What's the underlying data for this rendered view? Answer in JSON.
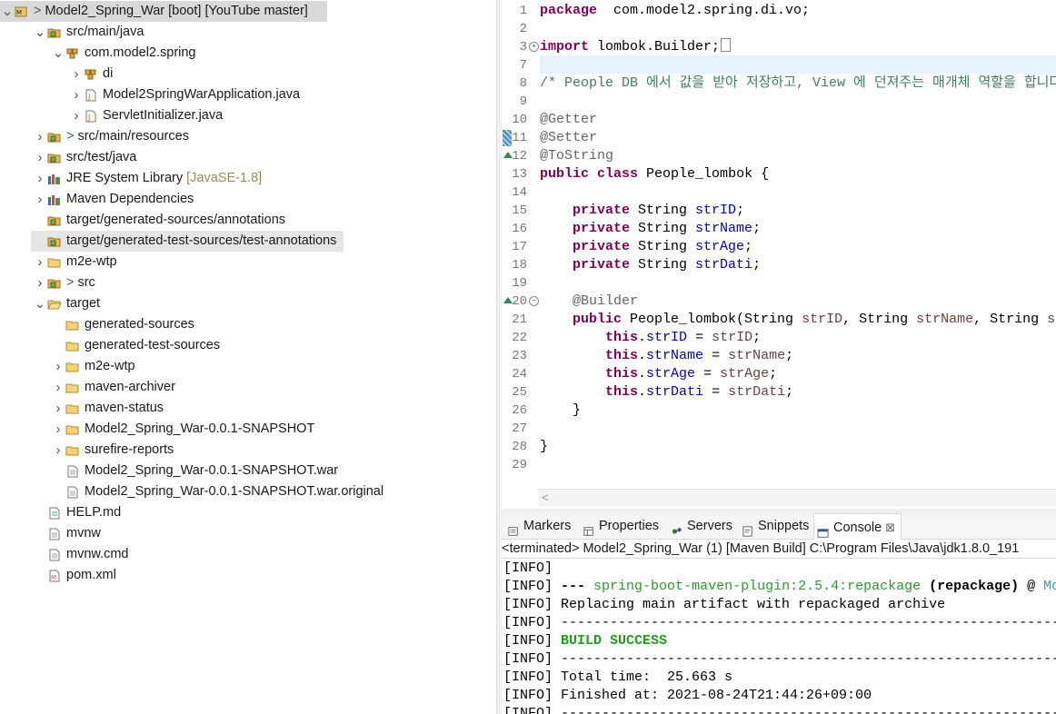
{
  "explorer": {
    "rows": [
      {
        "indent": 0,
        "twisty": "v",
        "icon": "maven-project-icon",
        "prefix": ">",
        "text": "Model2_Spring_War",
        "dim": " [boot] [YouTube master]",
        "selected": true
      },
      {
        "indent": 1,
        "twisty": "v",
        "icon": "source-folder-icon",
        "prefix": "",
        "text": "src/main/java",
        "dim": ""
      },
      {
        "indent": 2,
        "twisty": "v",
        "icon": "package-icon",
        "prefix": "",
        "text": "com.model2.spring",
        "dim": ""
      },
      {
        "indent": 3,
        "twisty": ">",
        "icon": "package-icon",
        "prefix": "",
        "text": "di",
        "dim": ""
      },
      {
        "indent": 3,
        "twisty": ">",
        "icon": "java-file-icon",
        "prefix": "",
        "text": "Model2SpringWarApplication.java",
        "dim": ""
      },
      {
        "indent": 3,
        "twisty": ">",
        "icon": "java-file-icon",
        "prefix": "",
        "text": "ServletInitializer.java",
        "dim": ""
      },
      {
        "indent": 1,
        "twisty": ">",
        "icon": "source-folder-icon",
        "prefix": ">",
        "text": "src/main/resources",
        "dim": ""
      },
      {
        "indent": 1,
        "twisty": ">",
        "icon": "source-folder-icon",
        "prefix": "",
        "text": "src/test/java",
        "dim": ""
      },
      {
        "indent": 1,
        "twisty": ">",
        "icon": "library-icon",
        "prefix": "",
        "text": "JRE System Library",
        "dim": " [JavaSE-1.8]"
      },
      {
        "indent": 1,
        "twisty": ">",
        "icon": "library-icon",
        "prefix": "",
        "text": "Maven Dependencies",
        "dim": ""
      },
      {
        "indent": 1,
        "twisty": "",
        "icon": "source-folder-icon",
        "prefix": "",
        "text": "target/generated-sources/annotations",
        "dim": ""
      },
      {
        "indent": 1,
        "twisty": "",
        "icon": "source-folder-icon",
        "prefix": "",
        "text": "target/generated-test-sources/test-annotations",
        "dim": "",
        "highlight": true
      },
      {
        "indent": 1,
        "twisty": ">",
        "icon": "folder-icon",
        "prefix": "",
        "text": "m2e-wtp",
        "dim": ""
      },
      {
        "indent": 1,
        "twisty": ">",
        "icon": "source-folder-icon",
        "prefix": ">",
        "text": "src",
        "dim": ""
      },
      {
        "indent": 1,
        "twisty": "v",
        "icon": "folder-open-icon",
        "prefix": "",
        "text": "target",
        "dim": ""
      },
      {
        "indent": 2,
        "twisty": "",
        "icon": "folder-icon",
        "prefix": "",
        "text": "generated-sources",
        "dim": ""
      },
      {
        "indent": 2,
        "twisty": "",
        "icon": "folder-icon",
        "prefix": "",
        "text": "generated-test-sources",
        "dim": ""
      },
      {
        "indent": 2,
        "twisty": ">",
        "icon": "folder-icon",
        "prefix": "",
        "text": "m2e-wtp",
        "dim": ""
      },
      {
        "indent": 2,
        "twisty": ">",
        "icon": "folder-icon",
        "prefix": "",
        "text": "maven-archiver",
        "dim": ""
      },
      {
        "indent": 2,
        "twisty": ">",
        "icon": "folder-icon",
        "prefix": "",
        "text": "maven-status",
        "dim": ""
      },
      {
        "indent": 2,
        "twisty": ">",
        "icon": "folder-icon",
        "prefix": "",
        "text": "Model2_Spring_War-0.0.1-SNAPSHOT",
        "dim": ""
      },
      {
        "indent": 2,
        "twisty": ">",
        "icon": "folder-icon",
        "prefix": "",
        "text": "surefire-reports",
        "dim": ""
      },
      {
        "indent": 2,
        "twisty": "",
        "icon": "file-icon",
        "prefix": "",
        "text": "Model2_Spring_War-0.0.1-SNAPSHOT.war",
        "dim": ""
      },
      {
        "indent": 2,
        "twisty": "",
        "icon": "file-icon",
        "prefix": "",
        "text": "Model2_Spring_War-0.0.1-SNAPSHOT.war.original",
        "dim": ""
      },
      {
        "indent": 1,
        "twisty": "",
        "icon": "markdown-file-icon",
        "prefix": "",
        "text": "HELP.md",
        "dim": ""
      },
      {
        "indent": 1,
        "twisty": "",
        "icon": "file-icon",
        "prefix": "",
        "text": "mvnw",
        "dim": ""
      },
      {
        "indent": 1,
        "twisty": "",
        "icon": "file-icon",
        "prefix": "",
        "text": "mvnw.cmd",
        "dim": ""
      },
      {
        "indent": 1,
        "twisty": "",
        "icon": "xml-file-icon",
        "prefix": "",
        "text": "pom.xml",
        "dim": ""
      }
    ]
  },
  "editor": {
    "lines": [
      {
        "n": "1",
        "parts": [
          [
            "kw",
            "package"
          ],
          [
            "",
            "  com.model2.spring.di.vo;"
          ]
        ]
      },
      {
        "n": "2",
        "parts": []
      },
      {
        "n": "3",
        "parts": [
          [
            "kw",
            "import"
          ],
          [
            "",
            " lombok.Builder;"
          ]
        ],
        "collapsed": true
      },
      {
        "n": "7",
        "parts": []
      },
      {
        "n": "8",
        "parts": [
          [
            "cmt",
            "/* People DB 에서 값을 받아 저장하고, View 에 던져주는 매개체 역할을 합니다. */"
          ]
        ]
      },
      {
        "n": "9",
        "parts": []
      },
      {
        "n": "10",
        "parts": [
          [
            "ann",
            "@Getter"
          ]
        ]
      },
      {
        "n": "11",
        "parts": [
          [
            "ann",
            "@Setter"
          ]
        ]
      },
      {
        "n": "12",
        "parts": [
          [
            "ann",
            "@ToString"
          ]
        ]
      },
      {
        "n": "13",
        "parts": [
          [
            "kw",
            "public"
          ],
          [
            "",
            " "
          ],
          [
            "kw",
            "class"
          ],
          [
            "",
            " People_lombok {"
          ]
        ]
      },
      {
        "n": "14",
        "parts": []
      },
      {
        "n": "15",
        "parts": [
          [
            "",
            "    "
          ],
          [
            "kw",
            "private"
          ],
          [
            "",
            " String "
          ],
          [
            "fld",
            "strID"
          ],
          [
            "",
            ";"
          ]
        ]
      },
      {
        "n": "16",
        "parts": [
          [
            "",
            "    "
          ],
          [
            "kw",
            "private"
          ],
          [
            "",
            " String "
          ],
          [
            "fld",
            "strName"
          ],
          [
            "",
            ";"
          ]
        ]
      },
      {
        "n": "17",
        "parts": [
          [
            "",
            "    "
          ],
          [
            "kw",
            "private"
          ],
          [
            "",
            " String "
          ],
          [
            "fld",
            "strAge"
          ],
          [
            "",
            ";"
          ]
        ]
      },
      {
        "n": "18",
        "parts": [
          [
            "",
            "    "
          ],
          [
            "kw",
            "private"
          ],
          [
            "",
            " String "
          ],
          [
            "fld",
            "strDati"
          ],
          [
            "",
            ";"
          ]
        ]
      },
      {
        "n": "19",
        "parts": []
      },
      {
        "n": "20",
        "parts": [
          [
            "",
            "    "
          ],
          [
            "ann",
            "@Builder"
          ]
        ]
      },
      {
        "n": "21",
        "parts": [
          [
            "",
            "    "
          ],
          [
            "kw",
            "public"
          ],
          [
            "",
            " People_lombok(String "
          ],
          [
            "var",
            "strID"
          ],
          [
            "",
            ", String "
          ],
          [
            "var",
            "strName"
          ],
          [
            "",
            ", String "
          ],
          [
            "var",
            "st"
          ]
        ]
      },
      {
        "n": "22",
        "parts": [
          [
            "",
            "        "
          ],
          [
            "kw",
            "this"
          ],
          [
            "",
            "."
          ],
          [
            "fld",
            "strID"
          ],
          [
            "",
            " = "
          ],
          [
            "var",
            "strID"
          ],
          [
            "",
            ";"
          ]
        ]
      },
      {
        "n": "23",
        "parts": [
          [
            "",
            "        "
          ],
          [
            "kw",
            "this"
          ],
          [
            "",
            "."
          ],
          [
            "fld",
            "strName"
          ],
          [
            "",
            " = "
          ],
          [
            "var",
            "strName"
          ],
          [
            "",
            ";"
          ]
        ]
      },
      {
        "n": "24",
        "parts": [
          [
            "",
            "        "
          ],
          [
            "kw",
            "this"
          ],
          [
            "",
            "."
          ],
          [
            "fld",
            "strAge"
          ],
          [
            "",
            " = "
          ],
          [
            "var",
            "strAge"
          ],
          [
            "",
            ";"
          ]
        ]
      },
      {
        "n": "25",
        "parts": [
          [
            "",
            "        "
          ],
          [
            "kw",
            "this"
          ],
          [
            "",
            "."
          ],
          [
            "fld",
            "strDati"
          ],
          [
            "",
            " = "
          ],
          [
            "var",
            "strDati"
          ],
          [
            "",
            ";"
          ]
        ]
      },
      {
        "n": "26",
        "parts": [
          [
            "",
            "    }"
          ]
        ]
      },
      {
        "n": "27",
        "parts": []
      },
      {
        "n": "28",
        "parts": [
          [
            "",
            "}"
          ]
        ]
      },
      {
        "n": "29",
        "parts": []
      }
    ]
  },
  "console": {
    "tabs": [
      {
        "name": "markers",
        "label": "Markers",
        "icon": "markers-icon"
      },
      {
        "name": "properties",
        "label": "Properties",
        "icon": "properties-icon"
      },
      {
        "name": "servers",
        "label": "Servers",
        "icon": "servers-icon"
      },
      {
        "name": "snippets",
        "label": "Snippets",
        "icon": "snippets-icon"
      },
      {
        "name": "console",
        "label": "Console",
        "icon": "console-icon",
        "active": true,
        "close": "⊠"
      }
    ],
    "status": "<terminated> Model2_Spring_War (1) [Maven Build] C:\\Program Files\\Java\\jdk1.8.0_191",
    "lines": [
      [
        [
          "",
          "[INFO]"
        ]
      ],
      [
        [
          "",
          "[INFO] "
        ],
        [
          "bld",
          "---"
        ],
        [
          "",
          " "
        ],
        [
          "grn",
          "spring-boot-maven-plugin:2.5.4:repackage"
        ],
        [
          "",
          " "
        ],
        [
          "bld",
          "(repackage)"
        ],
        [
          "",
          " @ "
        ],
        [
          "cyn",
          "Mo"
        ]
      ],
      [
        [
          "",
          "[INFO] Replacing main artifact with repackaged archive"
        ]
      ],
      [
        [
          "",
          "[INFO] ------------------------------------------------------------------------"
        ]
      ],
      [
        [
          "",
          "[INFO] "
        ],
        [
          "grnb",
          "BUILD SUCCESS"
        ]
      ],
      [
        [
          "",
          "[INFO] ------------------------------------------------------------------------"
        ]
      ],
      [
        [
          "",
          "[INFO] Total time:  25.663 s"
        ]
      ],
      [
        [
          "",
          "[INFO] Finished at: 2021-08-24T21:44:26+09:00"
        ]
      ],
      [
        [
          "",
          "[INFO] ------------------------------------------------------------------------"
        ]
      ]
    ]
  },
  "colors": {
    "keyword": "#7f0055",
    "field": "#0000c0",
    "comment": "#3f7f5f",
    "annotation": "#646464",
    "success": "#1f9d1f"
  }
}
